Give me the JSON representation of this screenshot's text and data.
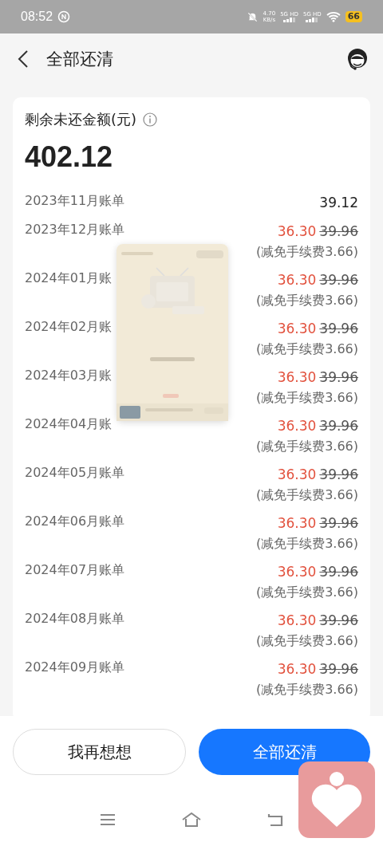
{
  "status_bar": {
    "time": "08:52",
    "speed": "4.70",
    "speed_unit": "KB/s",
    "sim1": "5G HD",
    "sim2": "5G HD",
    "battery": "66"
  },
  "header": {
    "title": "全部还清"
  },
  "summary": {
    "label": "剩余未还金额(元)",
    "amount": "402.12"
  },
  "bills": [
    {
      "kind": "plain",
      "label": "2023年11月账单",
      "amount": "39.12"
    },
    {
      "kind": "discounted",
      "label": "2023年12月账单",
      "amount": "36.30",
      "original": "39.96",
      "note": "(减免手续费3.66)"
    },
    {
      "kind": "discounted",
      "label": "2024年01月账",
      "amount": "36.30",
      "original": "39.96",
      "note": "(减免手续费3.66)"
    },
    {
      "kind": "discounted",
      "label": "2024年02月账",
      "amount": "36.30",
      "original": "39.96",
      "note": "(减免手续费3.66)"
    },
    {
      "kind": "discounted",
      "label": "2024年03月账",
      "amount": "36.30",
      "original": "39.96",
      "note": "(减免手续费3.66)"
    },
    {
      "kind": "discounted",
      "label": "2024年04月账",
      "amount": "36.30",
      "original": "39.96",
      "note": "(减免手续费3.66)"
    },
    {
      "kind": "discounted",
      "label": "2024年05月账单",
      "amount": "36.30",
      "original": "39.96",
      "note": "(减免手续费3.66)"
    },
    {
      "kind": "discounted",
      "label": "2024年06月账单",
      "amount": "36.30",
      "original": "39.96",
      "note": "(减免手续费3.66)"
    },
    {
      "kind": "discounted",
      "label": "2024年07月账单",
      "amount": "36.30",
      "original": "39.96",
      "note": "(减免手续费3.66)"
    },
    {
      "kind": "discounted",
      "label": "2024年08月账单",
      "amount": "36.30",
      "original": "39.96",
      "note": "(减免手续费3.66)"
    },
    {
      "kind": "discounted",
      "label": "2024年09月账单",
      "amount": "36.30",
      "original": "39.96",
      "note": "(减免手续费3.66)"
    }
  ],
  "buttons": [
    {
      "kind": "secondary",
      "label": "我再想想"
    },
    {
      "kind": "primary",
      "label": "全部还清"
    }
  ]
}
